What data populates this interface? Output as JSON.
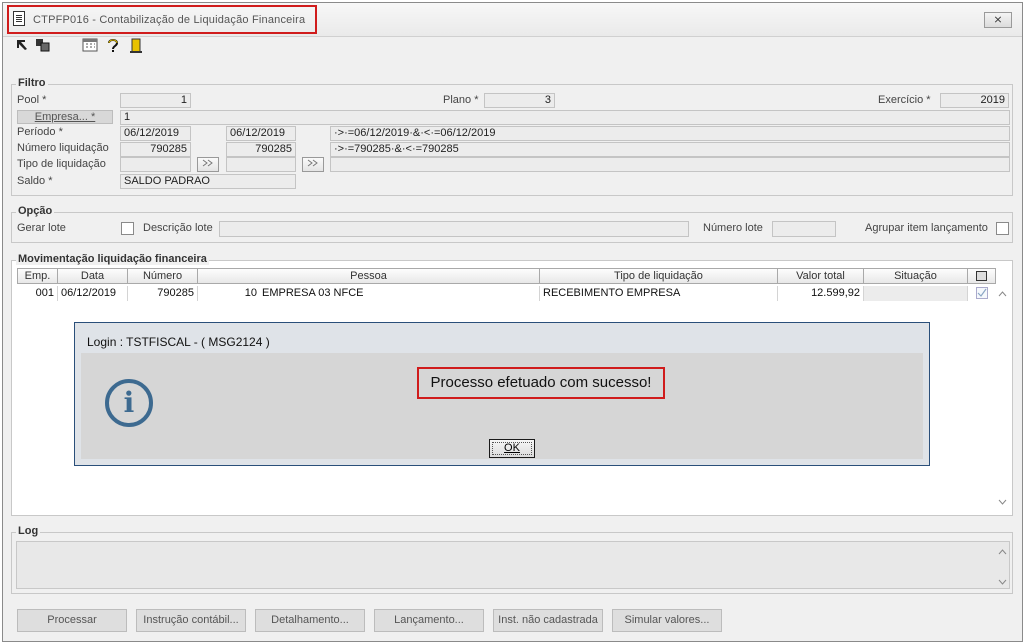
{
  "window": {
    "title": "CTPFP016 - Contabilização de Liquidação Financeira",
    "close_label": "⨯"
  },
  "toolbar": {
    "icons": [
      "arrow-icon",
      "copy-icon",
      "calendar-icon",
      "help-icon",
      "exit-icon"
    ]
  },
  "filtro": {
    "legend": "Filtro",
    "pool_label": "Pool *",
    "pool_value": "1",
    "plano_label": "Plano *",
    "plano_value": "3",
    "exercicio_label": "Exercício *",
    "exercicio_value": "2019",
    "empresa_button": "Empresa... *",
    "empresa_value": "1",
    "periodo_label": "Período *",
    "periodo_from": "06/12/2019",
    "periodo_to": "06/12/2019",
    "periodo_expr": "·>·=06/12/2019·&·<·=06/12/2019",
    "numero_label": "Número liquidação",
    "numero_from": "790285",
    "numero_to": "790285",
    "numero_expr": "·>·=790285·&·<·=790285",
    "tipo_label": "Tipo de liquidação",
    "saldo_label": "Saldo *",
    "saldo_value": "SALDO PADRAO"
  },
  "opcao": {
    "legend": "Opção",
    "gerar_lote_label": "Gerar lote",
    "descricao_lote_label": "Descrição lote",
    "numero_lote_label": "Número lote",
    "agrupar_label": "Agrupar item lançamento"
  },
  "movimentacao": {
    "legend": "Movimentação liquidação financeira",
    "columns": [
      "Emp.",
      "Data",
      "Número",
      "Pessoa",
      "Tipo de liquidação",
      "Valor total",
      "Situação"
    ],
    "rows": [
      {
        "emp": "001",
        "data": "06/12/2019",
        "numero": "790285",
        "pessoa_code": "10",
        "pessoa": "EMPRESA 03 NFCE",
        "tipo": "RECEBIMENTO EMPRESA",
        "valor": "12.599,92",
        "situacao": ""
      }
    ]
  },
  "log": {
    "legend": "Log"
  },
  "buttons": {
    "processar": "Processar",
    "instrucao": "Instrução contábil...",
    "detalhamento": "Detalhamento...",
    "lancamento": "Lançamento...",
    "inst_nao_cadastrada": "Inst. não cadastrada",
    "simular": "Simular valores..."
  },
  "dialog": {
    "title": "Login : TSTFISCAL - ( MSG2124 )",
    "message": "Processo efetuado com sucesso!",
    "ok_label": "OK",
    "icon": "info-icon"
  },
  "colors": {
    "highlight": "#d01c1c",
    "info_icon": "#3d6a90",
    "dialog_border": "#2a4f7a"
  }
}
